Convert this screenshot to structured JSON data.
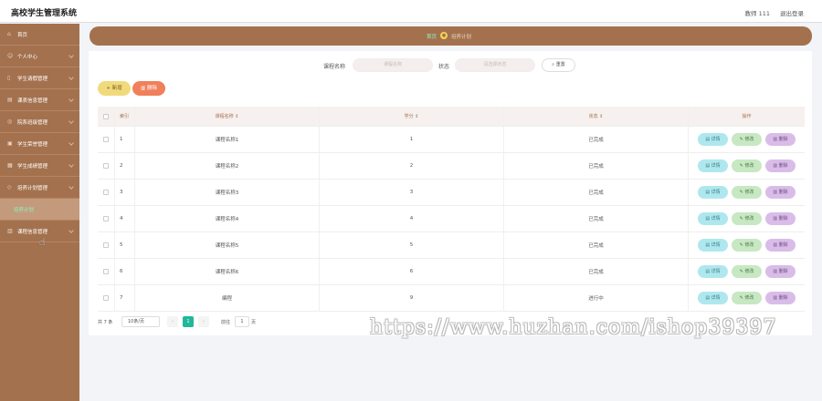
{
  "app": {
    "title": "高校学生管理系统"
  },
  "header": {
    "user": "教师 111",
    "logout": "退出登录"
  },
  "sidebar": {
    "items": [
      {
        "label": "首页",
        "icon": "home-icon"
      },
      {
        "label": "个人中心",
        "icon": "user-icon"
      },
      {
        "label": "学生请假管理",
        "icon": "doc-icon"
      },
      {
        "label": "课表信息管理",
        "icon": "table-icon"
      },
      {
        "label": "院系班级管理",
        "icon": "org-icon"
      },
      {
        "label": "学生荣誉管理",
        "icon": "award-icon"
      },
      {
        "label": "学生成绩管理",
        "icon": "grade-icon"
      },
      {
        "label": "培养计划管理",
        "icon": "plan-icon"
      },
      {
        "label": "培养计划",
        "icon": "",
        "active": true
      },
      {
        "label": "课程信息管理",
        "icon": "course-icon"
      }
    ]
  },
  "breadcrumb": {
    "home": "首页",
    "current": "培养计划"
  },
  "search": {
    "name_label": "课程名称",
    "name_placeholder": "课程名称",
    "status_label": "状态",
    "status_placeholder": "请选择状态",
    "reset_label": "重置"
  },
  "actions": {
    "add_label": "新增",
    "delete_label": "删除"
  },
  "table": {
    "headers": {
      "index": "索引",
      "name": "课程名称 ⇕",
      "credit": "学分 ⇕",
      "status": "状态 ⇕",
      "ops": "操作"
    },
    "op_labels": {
      "detail": "详情",
      "edit": "修改",
      "delete": "删除"
    },
    "rows": [
      {
        "index": "1",
        "name": "课程名称1",
        "credit": "1",
        "status": "已完成"
      },
      {
        "index": "2",
        "name": "课程名称2",
        "credit": "2",
        "status": "已完成"
      },
      {
        "index": "3",
        "name": "课程名称3",
        "credit": "3",
        "status": "已完成"
      },
      {
        "index": "4",
        "name": "课程名称4",
        "credit": "4",
        "status": "已完成"
      },
      {
        "index": "5",
        "name": "课程名称5",
        "credit": "5",
        "status": "已完成"
      },
      {
        "index": "6",
        "name": "课程名称6",
        "credit": "6",
        "status": "已完成"
      },
      {
        "index": "7",
        "name": "编程",
        "credit": "9",
        "status": "进行中"
      }
    ]
  },
  "pagination": {
    "total": "共 7 条",
    "page_size": "10条/页",
    "prev": "‹",
    "current": "1",
    "next": "›",
    "goto_label": "前往",
    "goto_value": "1",
    "unit": "页"
  },
  "watermark": "https://www.huzhan.com/ishop39397"
}
